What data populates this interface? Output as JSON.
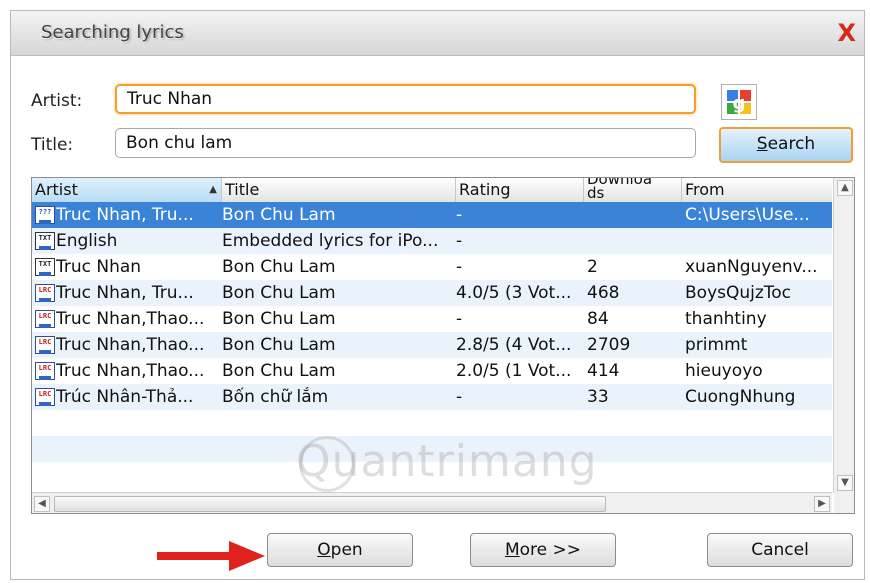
{
  "window": {
    "title": "Searching lyrics",
    "close_label": "X"
  },
  "form": {
    "artist_label": "Artist:",
    "artist_value": "Truc Nhan",
    "title_label": "Title:",
    "title_value": "Bon chu lam",
    "search_button": "Search",
    "search_mnemonic": "S",
    "search_rest": "earch"
  },
  "table": {
    "columns": [
      "Artist",
      "Title",
      "Rating",
      "Downloads",
      "From"
    ],
    "downloads_header": "Downloa\nds",
    "rows": [
      {
        "icon": "???",
        "artist": "Truc Nhan, Tru...",
        "title": "Bon Chu Lam",
        "rating": "-",
        "downloads": "",
        "from": "C:\\Users\\Use...",
        "selected": true
      },
      {
        "icon": "TXT",
        "artist": "English",
        "title": "Embedded lyrics for iPo...",
        "rating": "-",
        "downloads": "",
        "from": ""
      },
      {
        "icon": "TXT",
        "artist": "Truc Nhan",
        "title": "Bon Chu Lam",
        "rating": "-",
        "downloads": "2",
        "from": "xuanNguyenv..."
      },
      {
        "icon": "LRC",
        "artist": "Truc Nhan, Tru...",
        "title": "Bon Chu Lam",
        "rating": "4.0/5 (3 Vot...",
        "downloads": "468",
        "from": "BoysQujzToc"
      },
      {
        "icon": "LRC",
        "artist": "Truc Nhan,Thao...",
        "title": "Bon Chu Lam",
        "rating": "-",
        "downloads": "84",
        "from": "thanhtiny"
      },
      {
        "icon": "LRC",
        "artist": "Truc Nhan,Thao...",
        "title": "Bon Chu Lam",
        "rating": "2.8/5 (4 Vot...",
        "downloads": "2709",
        "from": "primmt"
      },
      {
        "icon": "LRC",
        "artist": "Truc Nhan,Thao...",
        "title": "Bon Chu Lam",
        "rating": "2.0/5 (1 Vot...",
        "downloads": "414",
        "from": "hieuyoyo"
      },
      {
        "icon": "LRC",
        "artist": "Trúc Nhân-Thả...",
        "title": "Bốn chữ lắm",
        "rating": "-",
        "downloads": "33",
        "from": "CuongNhung"
      }
    ]
  },
  "buttons": {
    "open": "Open",
    "open_u": "O",
    "open_rest": "pen",
    "more": "More >>",
    "more_u": "M",
    "more_rest": "ore >>",
    "cancel": "Cancel"
  },
  "watermark": "Quantrimang",
  "colors": {
    "accent_orange": "#f0a030",
    "selection_blue": "#3a83d6",
    "close_red": "#d42a1a",
    "arrow_red": "#e0221a"
  }
}
